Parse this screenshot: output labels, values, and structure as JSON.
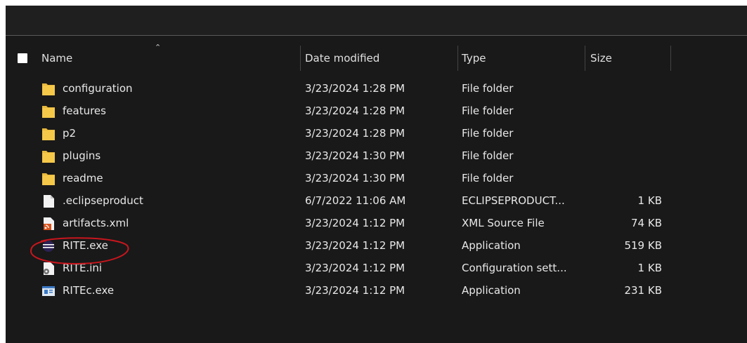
{
  "columns": {
    "name": "Name",
    "date": "Date modified",
    "type": "Type",
    "size": "Size"
  },
  "files": [
    {
      "name": "configuration",
      "date": "3/23/2024 1:28 PM",
      "type": "File folder",
      "size": "",
      "icon": "folder-icon"
    },
    {
      "name": "features",
      "date": "3/23/2024 1:28 PM",
      "type": "File folder",
      "size": "",
      "icon": "folder-icon"
    },
    {
      "name": "p2",
      "date": "3/23/2024 1:28 PM",
      "type": "File folder",
      "size": "",
      "icon": "folder-icon"
    },
    {
      "name": "plugins",
      "date": "3/23/2024 1:30 PM",
      "type": "File folder",
      "size": "",
      "icon": "folder-icon"
    },
    {
      "name": "readme",
      "date": "3/23/2024 1:30 PM",
      "type": "File folder",
      "size": "",
      "icon": "folder-icon"
    },
    {
      "name": ".eclipseproduct",
      "date": "6/7/2022 11:06 AM",
      "type": "ECLIPSEPRODUCT...",
      "size": "1 KB",
      "icon": "file-icon"
    },
    {
      "name": "artifacts.xml",
      "date": "3/23/2024 1:12 PM",
      "type": "XML Source File",
      "size": "74 KB",
      "icon": "xml-file-icon"
    },
    {
      "name": "RITE.exe",
      "date": "3/23/2024 1:12 PM",
      "type": "Application",
      "size": "519 KB",
      "icon": "eclipse-app-icon"
    },
    {
      "name": "RITE.ini",
      "date": "3/23/2024 1:12 PM",
      "type": "Configuration sett...",
      "size": "1 KB",
      "icon": "settings-file-icon"
    },
    {
      "name": "RITEc.exe",
      "date": "3/23/2024 1:12 PM",
      "type": "Application",
      "size": "231 KB",
      "icon": "console-app-icon"
    }
  ],
  "colors": {
    "background": "#191919",
    "text": "#e8e8e8",
    "folder": "#e8b93c",
    "annotation": "#c8161d"
  }
}
